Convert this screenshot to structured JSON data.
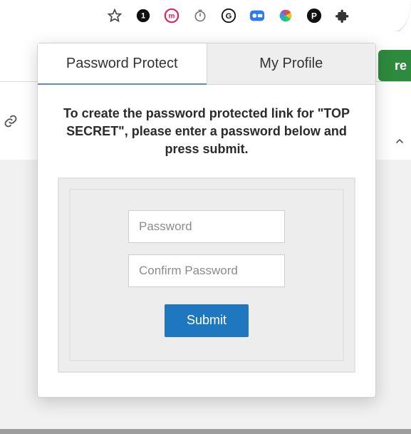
{
  "browser_icons": [
    "star-icon",
    "notification-icon",
    "m-circle-icon",
    "timer-icon",
    "g-circle-icon",
    "camera-icon",
    "color-wheel-icon",
    "p-circle-icon",
    "puzzle-icon"
  ],
  "page": {
    "share_label_visible": "re"
  },
  "popup": {
    "tabs": {
      "password_protect": "Password Protect",
      "my_profile": "My Profile"
    },
    "instruction": "To create the password protected link for \"TOP SECRET\", please enter a password below and press submit.",
    "form": {
      "password_placeholder": "Password",
      "confirm_placeholder": "Confirm Password",
      "submit_label": "Submit"
    }
  }
}
